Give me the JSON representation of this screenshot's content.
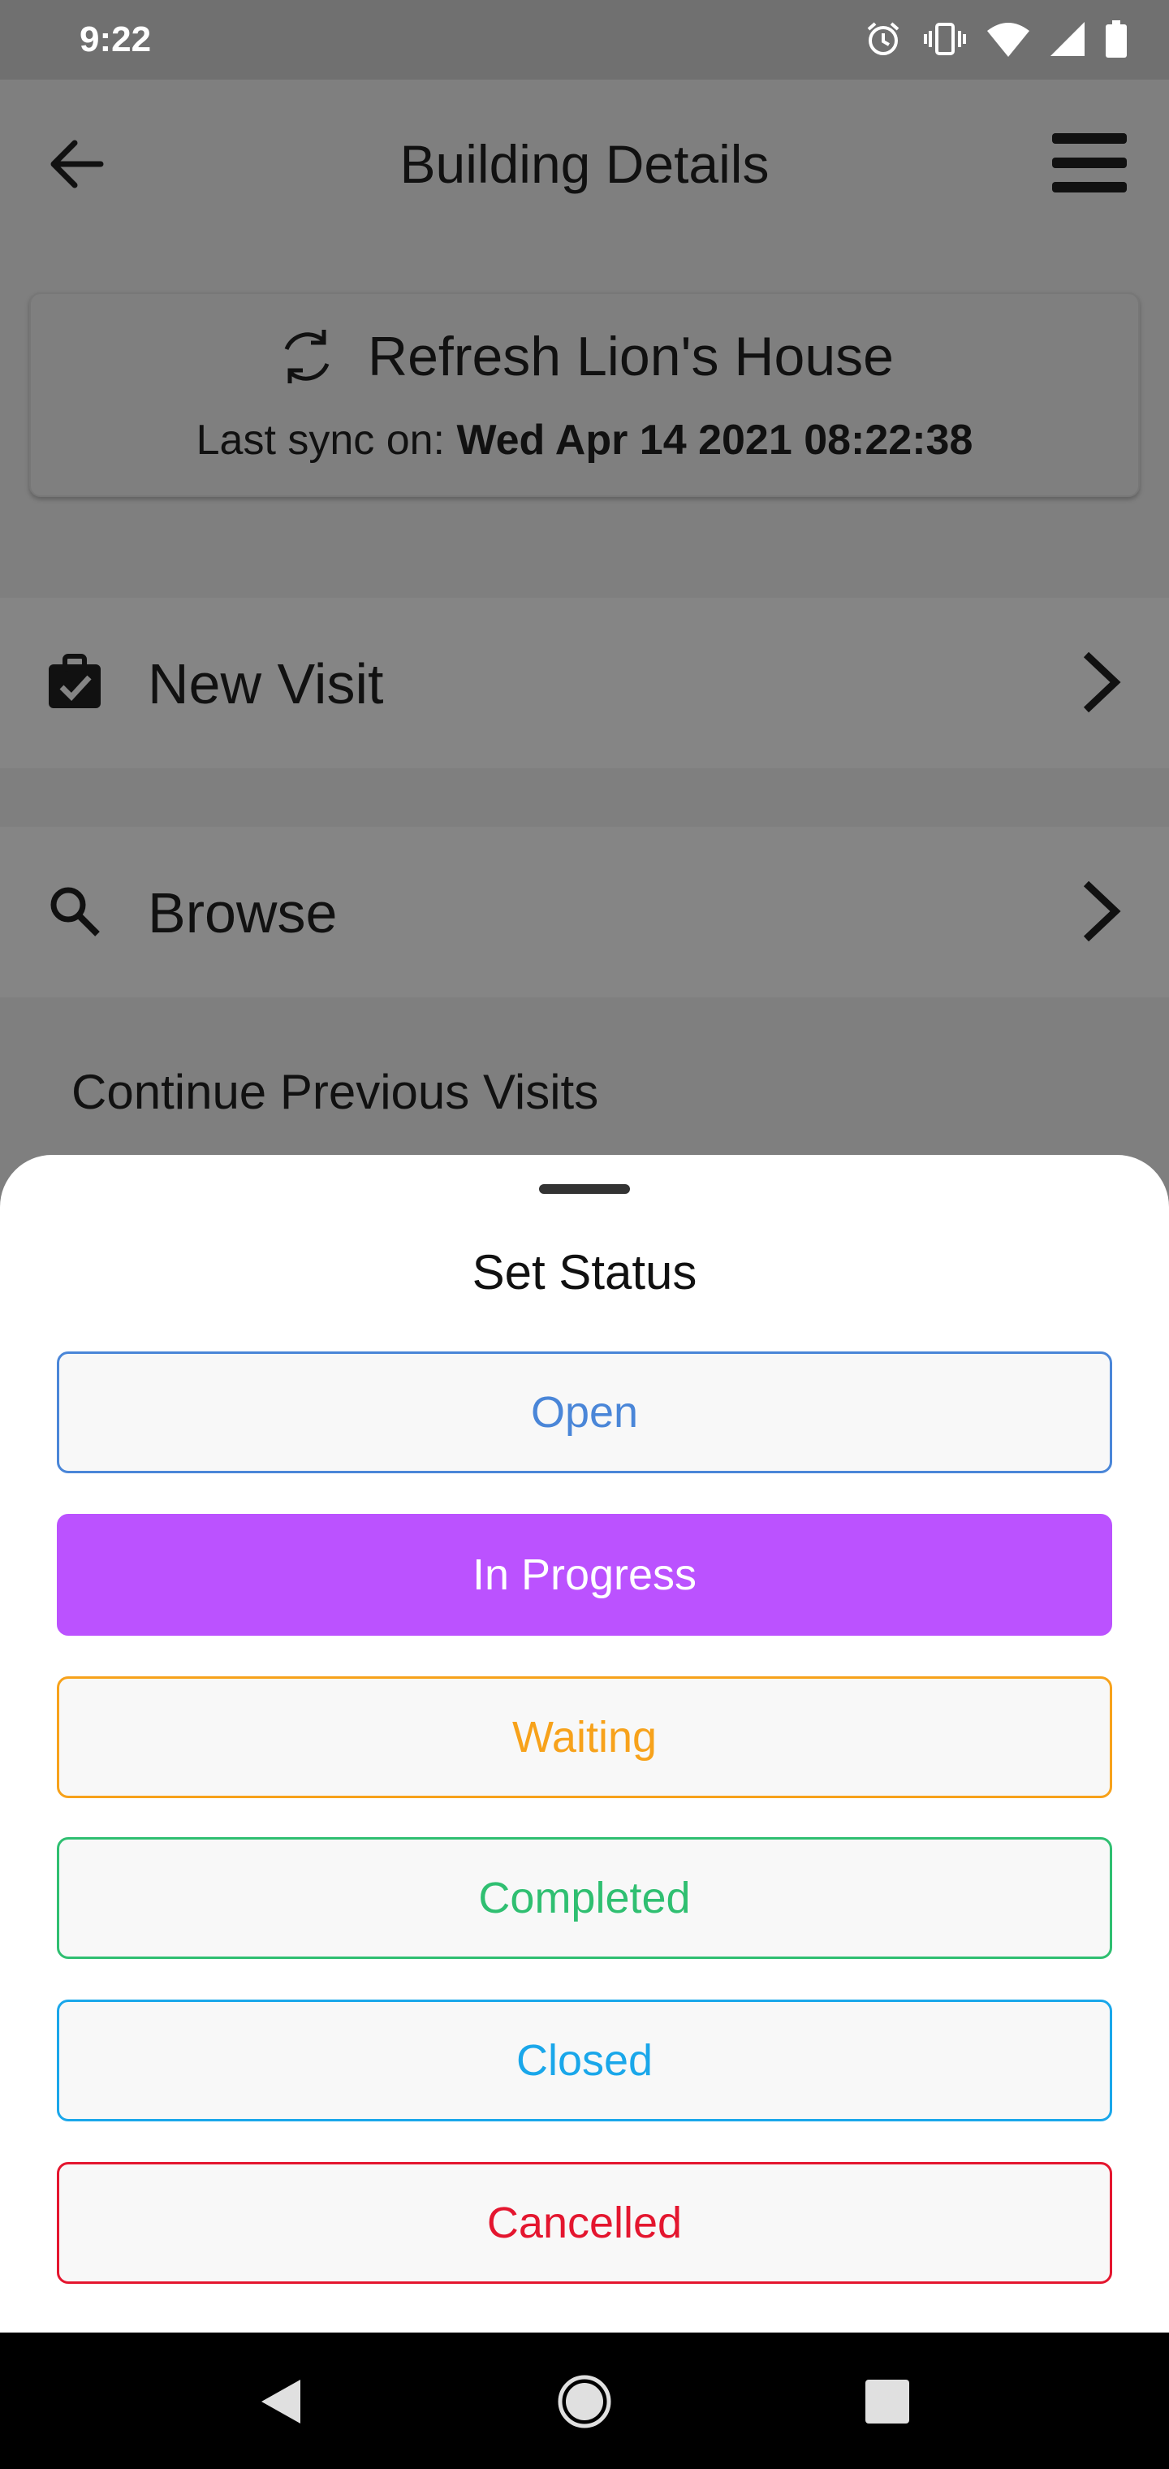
{
  "status_bar": {
    "time": "9:22",
    "icons": [
      "alarm-icon",
      "vibrate-icon",
      "wifi-icon",
      "signal-icon",
      "battery-icon"
    ]
  },
  "app_bar": {
    "title": "Building Details",
    "back_icon": "arrow-left-icon",
    "menu_icon": "hamburger-menu-icon"
  },
  "sync_card": {
    "refresh_label": "Refresh Lion's House",
    "last_sync_prefix": "Last sync on:",
    "last_sync_value": "Wed Apr 14 2021 08:22:38",
    "icon": "sync-icon"
  },
  "menu": [
    {
      "label": "New Visit",
      "icon": "clipboard-check-icon"
    },
    {
      "label": "Browse",
      "icon": "search-icon"
    }
  ],
  "section_label": "Continue Previous Visits",
  "sheet": {
    "title": "Set Status",
    "options": [
      {
        "label": "Open",
        "color": "#4a86d8",
        "selected": false
      },
      {
        "label": "In Progress",
        "color": "#bb52ff",
        "selected": true
      },
      {
        "label": "Waiting",
        "color": "#f7a21b",
        "selected": false
      },
      {
        "label": "Completed",
        "color": "#2fbf71",
        "selected": false
      },
      {
        "label": "Closed",
        "color": "#1aa7ea",
        "selected": false
      },
      {
        "label": "Cancelled",
        "color": "#e4162f",
        "selected": false
      }
    ]
  },
  "nav_bar": {
    "buttons": [
      "back-triangle-icon",
      "home-circle-icon",
      "recents-square-icon"
    ]
  }
}
